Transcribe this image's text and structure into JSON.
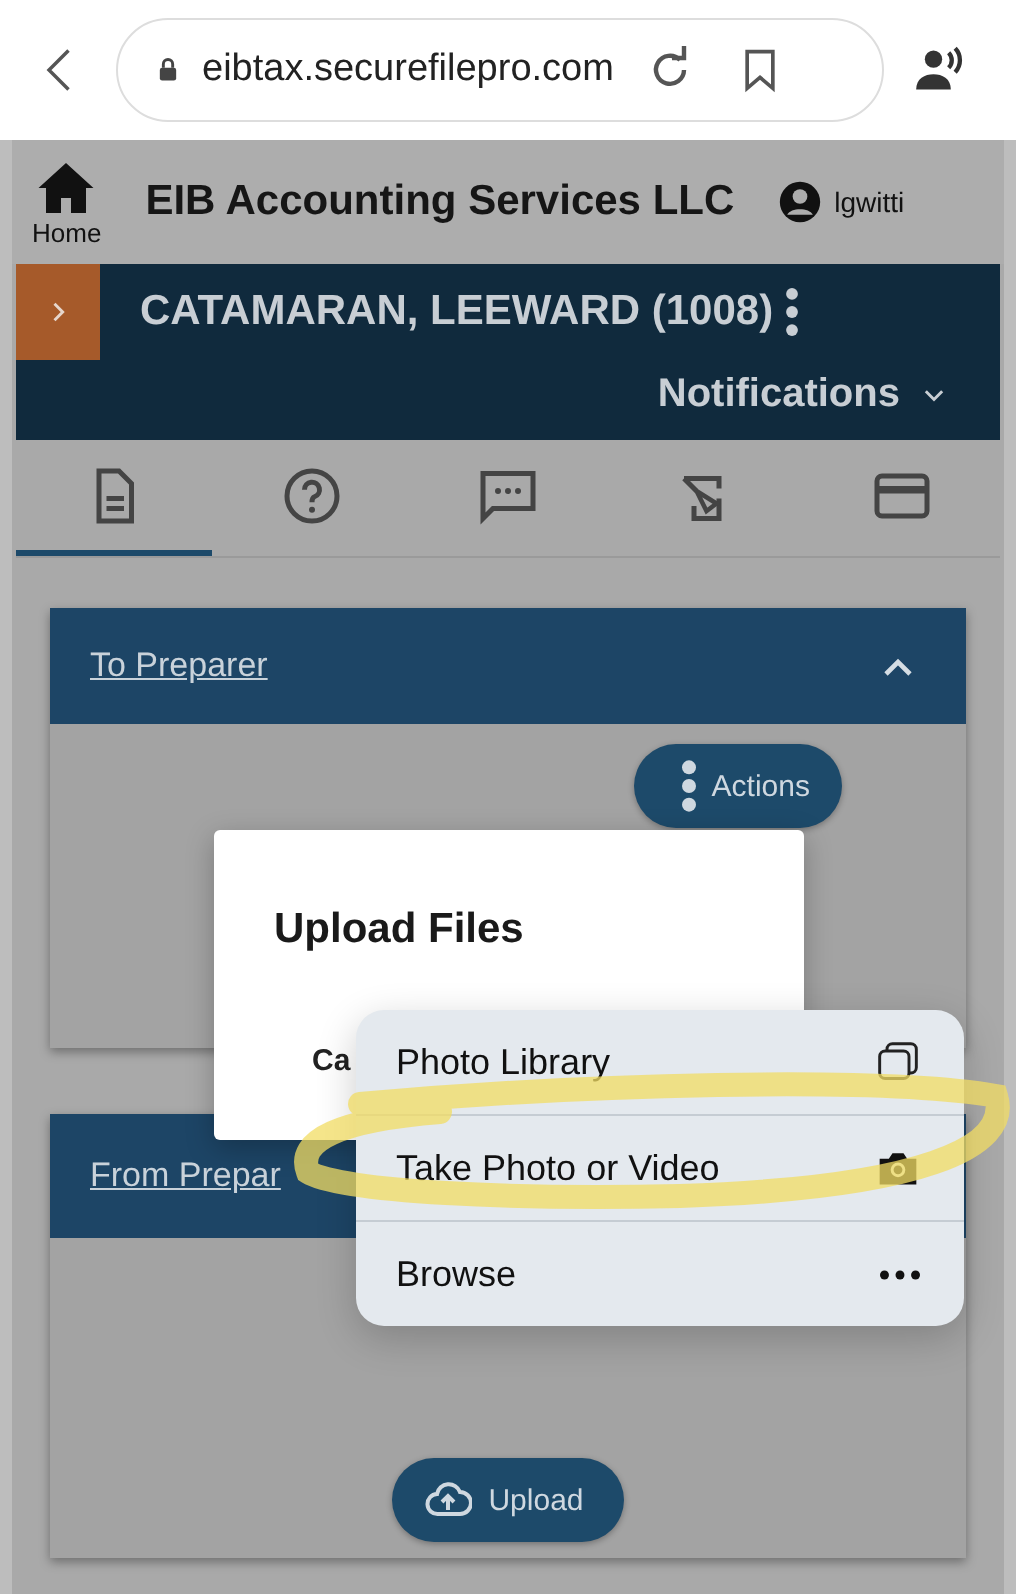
{
  "browser": {
    "url": "eibtax.securefilepro.com"
  },
  "header": {
    "home_label": "Home",
    "firm_name": "EIB Accounting Services LLC",
    "user": "lgwitti"
  },
  "client_bar": {
    "client": "CATAMARAN, LEEWARD (1008)",
    "notifications": "Notifications"
  },
  "tabs": [
    {
      "kind": "document",
      "selected": true
    },
    {
      "kind": "help",
      "selected": false
    },
    {
      "kind": "chat",
      "selected": false
    },
    {
      "kind": "sign",
      "selected": false
    },
    {
      "kind": "card",
      "selected": false
    }
  ],
  "sections": [
    {
      "title": "To Preparer",
      "expanded": true,
      "buttons": [
        {
          "kind": "actions",
          "label": "Actions"
        }
      ]
    },
    {
      "title": "From Prepar",
      "buttons": [
        {
          "kind": "upload",
          "label": "Upload"
        }
      ]
    }
  ],
  "dialog": {
    "title": "Upload Files",
    "cancel": "Ca"
  },
  "picker": [
    {
      "kind": "library",
      "label": "Photo Library"
    },
    {
      "kind": "camera",
      "label": "Take Photo or Video"
    },
    {
      "kind": "more",
      "label": "Browse"
    }
  ]
}
